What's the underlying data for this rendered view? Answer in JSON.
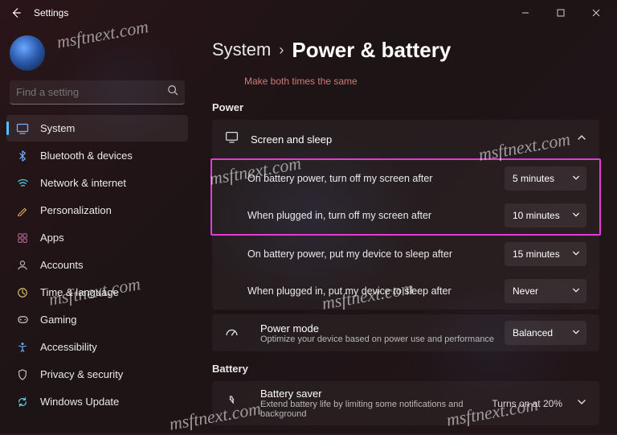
{
  "titlebar": {
    "appname": "Settings"
  },
  "sidebar": {
    "search_placeholder": "Find a setting",
    "items": [
      {
        "label": "System"
      },
      {
        "label": "Bluetooth & devices"
      },
      {
        "label": "Network & internet"
      },
      {
        "label": "Personalization"
      },
      {
        "label": "Apps"
      },
      {
        "label": "Accounts"
      },
      {
        "label": "Time & language"
      },
      {
        "label": "Gaming"
      },
      {
        "label": "Accessibility"
      },
      {
        "label": "Privacy & security"
      },
      {
        "label": "Windows Update"
      }
    ]
  },
  "breadcrumb": {
    "root": "System",
    "here": "Power & battery"
  },
  "stray_link": "Make both times the same",
  "sections": {
    "power": "Power",
    "battery": "Battery"
  },
  "screen_sleep": {
    "title": "Screen and sleep",
    "rows": [
      {
        "label": "On battery power, turn off my screen after",
        "value": "5 minutes"
      },
      {
        "label": "When plugged in, turn off my screen after",
        "value": "10 minutes"
      },
      {
        "label": "On battery power, put my device to sleep after",
        "value": "15 minutes"
      },
      {
        "label": "When plugged in, put my device to sleep after",
        "value": "Never"
      }
    ]
  },
  "power_mode": {
    "title": "Power mode",
    "subtitle": "Optimize your device based on power use and performance",
    "value": "Balanced"
  },
  "battery_saver": {
    "title": "Battery saver",
    "subtitle": "Extend battery life by limiting some notifications and background",
    "status": "Turns on at 20%"
  },
  "watermark": "msftnext.com"
}
